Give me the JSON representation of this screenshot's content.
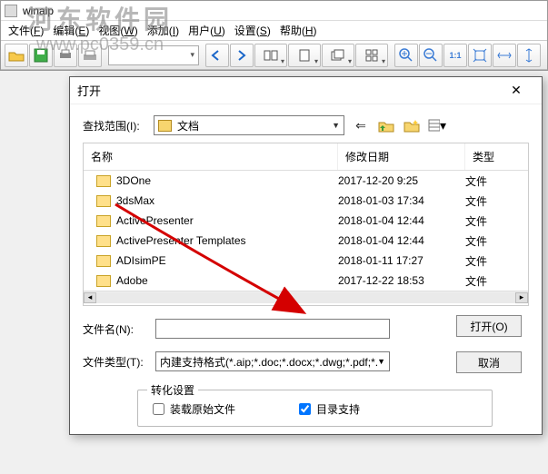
{
  "window": {
    "title": "winaip"
  },
  "watermark": {
    "line1": "河东软件园",
    "line2": "www.pc0359.cn"
  },
  "menu": {
    "file": "文件",
    "file_u": "F",
    "edit": "编辑",
    "edit_u": "E",
    "view": "视图",
    "view_u": "W",
    "add": "添加",
    "add_u": "I",
    "user": "用户",
    "user_u": "U",
    "settings": "设置",
    "settings_u": "S",
    "help": "帮助",
    "help_u": "H"
  },
  "toolbar_icons": {
    "open": "📂",
    "save": "💾",
    "print": "🖨",
    "scan": "📠",
    "back": "⇦",
    "forward": "⇨",
    "book": "📖",
    "doc": "📄",
    "stack": "🗂",
    "grid": "▦",
    "zoomin": "🔍+",
    "zoomout": "🔍-",
    "fit11": "1:1",
    "fitw": "⤢",
    "fith": "↔",
    "fitp": "↕"
  },
  "dialog": {
    "title": "打开",
    "lookin_label": "查找范围(I):",
    "lookin_value": "文档",
    "columns": {
      "name": "名称",
      "date": "修改日期",
      "type": "类型"
    },
    "items": [
      {
        "name": "3DOne",
        "date": "2017-12-20 9:25",
        "type": "文件"
      },
      {
        "name": "3dsMax",
        "date": "2018-01-03 17:34",
        "type": "文件"
      },
      {
        "name": "ActivePresenter",
        "date": "2018-01-04 12:44",
        "type": "文件"
      },
      {
        "name": "ActivePresenter Templates",
        "date": "2018-01-04 12:44",
        "type": "文件"
      },
      {
        "name": "ADIsimPE",
        "date": "2018-01-11 17:27",
        "type": "文件"
      },
      {
        "name": "Adobe",
        "date": "2017-12-22 18:53",
        "type": "文件"
      }
    ],
    "filename_label": "文件名(N):",
    "filename_value": "",
    "filetype_label": "文件类型(T):",
    "filetype_value": "内建支持格式(*.aip;*.doc;*.docx;*.dwg;*.pdf;*.p",
    "open_btn": "打开(O)",
    "cancel_btn": "取消",
    "convert_legend": "转化设置",
    "opt_raw": "装载原始文件",
    "opt_dir": "目录支持",
    "opt_raw_checked": false,
    "opt_dir_checked": true
  }
}
